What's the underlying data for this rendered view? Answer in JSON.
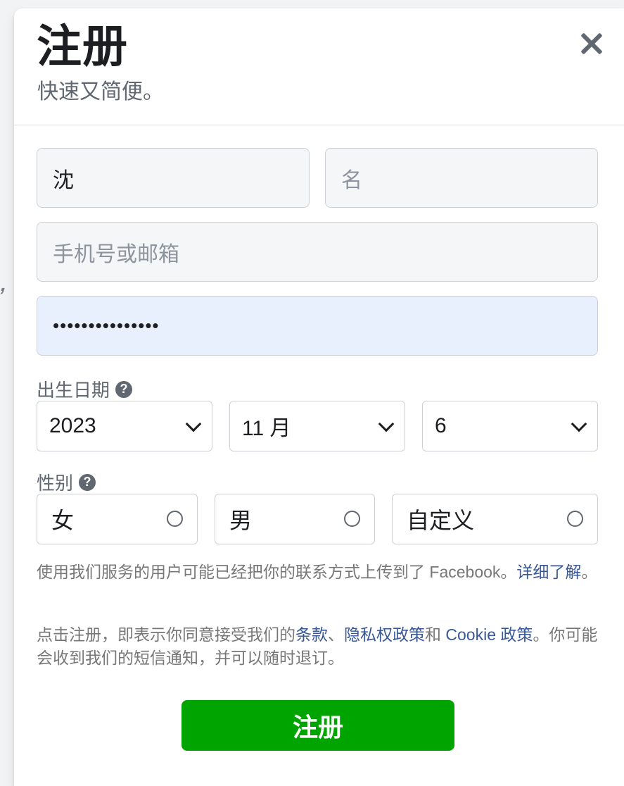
{
  "header": {
    "title": "注册",
    "subtitle": "快速又简便。"
  },
  "fields": {
    "surname_value": "沈",
    "given_name_placeholder": "名",
    "contact_placeholder": "手机号或邮箱",
    "password_mask": "•••••••••••••••"
  },
  "birthday": {
    "label": "出生日期",
    "help_icon": "question-circle-icon",
    "year": "2023",
    "month": "11 月",
    "day": "6"
  },
  "gender": {
    "label": "性别",
    "help_icon": "question-circle-icon",
    "options": [
      "女",
      "男",
      "自定义"
    ]
  },
  "notice": {
    "text": "使用我们服务的用户可能已经把你的联系方式上传到了 Facebook。",
    "link": "详细了解",
    "end": "。"
  },
  "terms": {
    "prefix": "点击注册，即表示你同意接受我们的",
    "terms_link": "条款",
    "sep": "、",
    "privacy_link": "隐私权政策",
    "and": "和 ",
    "cookie_link": "Cookie 政策",
    "suffix": "。你可能会收到我们的短信通知，并可以随时退订。"
  },
  "submit_label": "注册",
  "colors": {
    "submit_bg": "#00a400",
    "link": "#385898",
    "autofill_bg": "#e8f0fe"
  }
}
